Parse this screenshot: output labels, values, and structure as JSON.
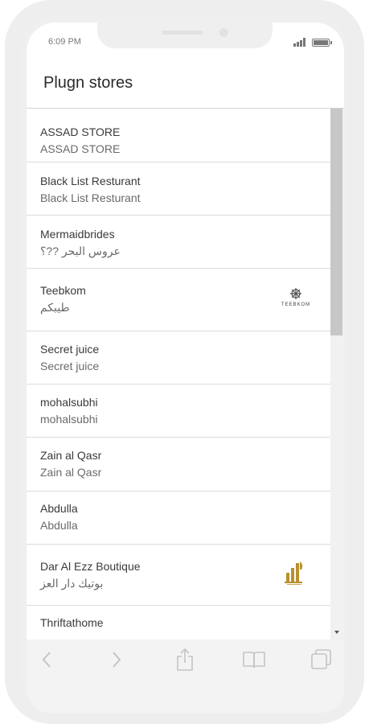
{
  "status_bar": {
    "time": "6:09 PM"
  },
  "header": {
    "title": "Plugn stores"
  },
  "stores": [
    {
      "name": "ASSAD STORE",
      "subtitle": "ASSAD STORE",
      "logo": ""
    },
    {
      "name": "Black List Resturant",
      "subtitle": "Black List Resturant",
      "logo": ""
    },
    {
      "name": "Mermaidbrides",
      "subtitle": "عروس البحر ??؟",
      "logo": ""
    },
    {
      "name": "Teebkom",
      "subtitle": "طيبكم",
      "logo": "teebkom-logo",
      "logo_text": "TEEBKOM"
    },
    {
      "name": "Secret juice",
      "subtitle": "Secret juice",
      "logo": ""
    },
    {
      "name": "mohalsubhi",
      "subtitle": "mohalsubhi",
      "logo": ""
    },
    {
      "name": "Zain al Qasr",
      "subtitle": "Zain al Qasr",
      "logo": ""
    },
    {
      "name": "Abdulla",
      "subtitle": "Abdulla",
      "logo": ""
    },
    {
      "name": "Dar Al Ezz Boutique",
      "subtitle": "بوتيك دار العز",
      "logo": "dar-al-ezz-logo"
    },
    {
      "name": "Thriftathome",
      "subtitle": "",
      "logo": ""
    }
  ],
  "toolbar": {
    "icons": [
      "back-icon",
      "forward-icon",
      "share-icon",
      "bookmarks-icon",
      "tabs-icon"
    ]
  },
  "colors": {
    "logo_gold": "#b8902e",
    "scroll_thumb": "#c7c7c7"
  }
}
